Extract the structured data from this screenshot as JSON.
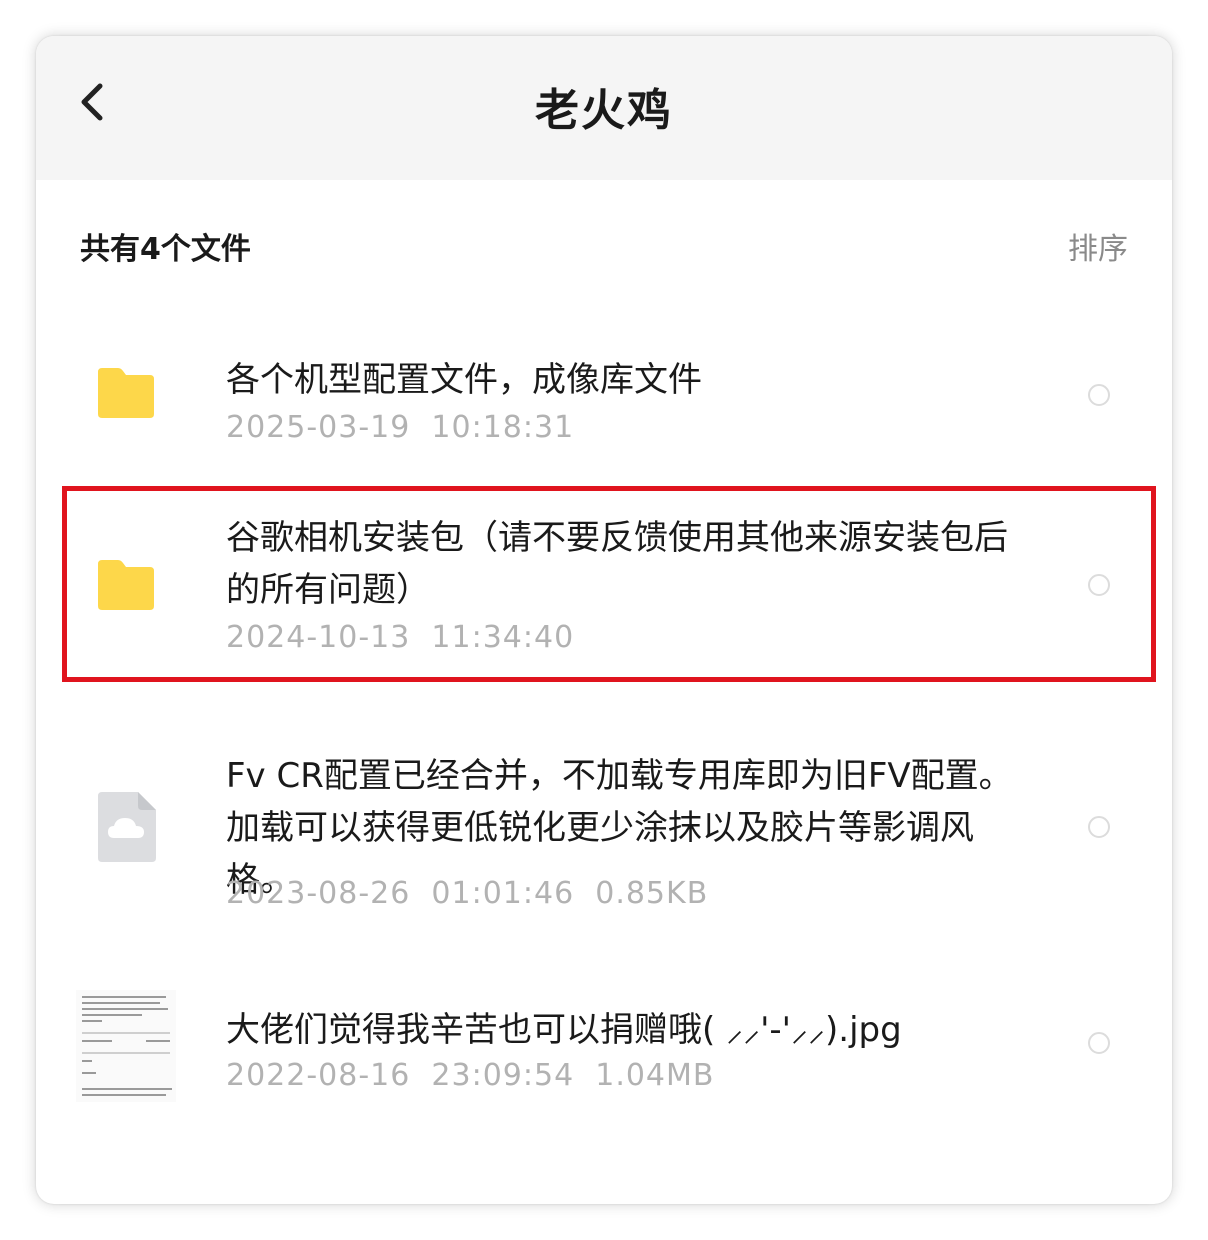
{
  "header": {
    "title": "老火鸡",
    "back_icon": "chevron-left-icon"
  },
  "summary": {
    "count_label": "共有4个文件",
    "sort_label": "排序"
  },
  "files": [
    {
      "name": "各个机型配置文件，成像库文件",
      "meta": "2025-03-19  10:18:31",
      "icon": "folder-icon",
      "highlighted": false
    },
    {
      "name": "谷歌相机安装包（请不要反馈使用其他来源安装包后的所有问题）",
      "meta": "2024-10-13  11:34:40",
      "icon": "folder-icon",
      "highlighted": true
    },
    {
      "name": "Fv CR配置已经合并，不加载专用库即为旧FV配置。加载可以获得更低锐化更少涂抹以及胶片等影调风格。",
      "meta": "2023-08-26  01:01:46  0.85KB",
      "icon": "cloud-file-icon",
      "highlighted": false
    },
    {
      "name": "大佬们觉得我辛苦也可以捐赠哦( ⸝⸝'-'⸝⸝).jpg",
      "meta": "2022-08-16  23:09:54  1.04MB",
      "icon": "image-thumbnail",
      "highlighted": false
    }
  ],
  "colors": {
    "header_bg": "#f5f5f5",
    "folder": "#fdd74a",
    "highlight": "#e0141e",
    "meta_text": "#b2b2b2",
    "sort_text": "#8a8a8a"
  }
}
